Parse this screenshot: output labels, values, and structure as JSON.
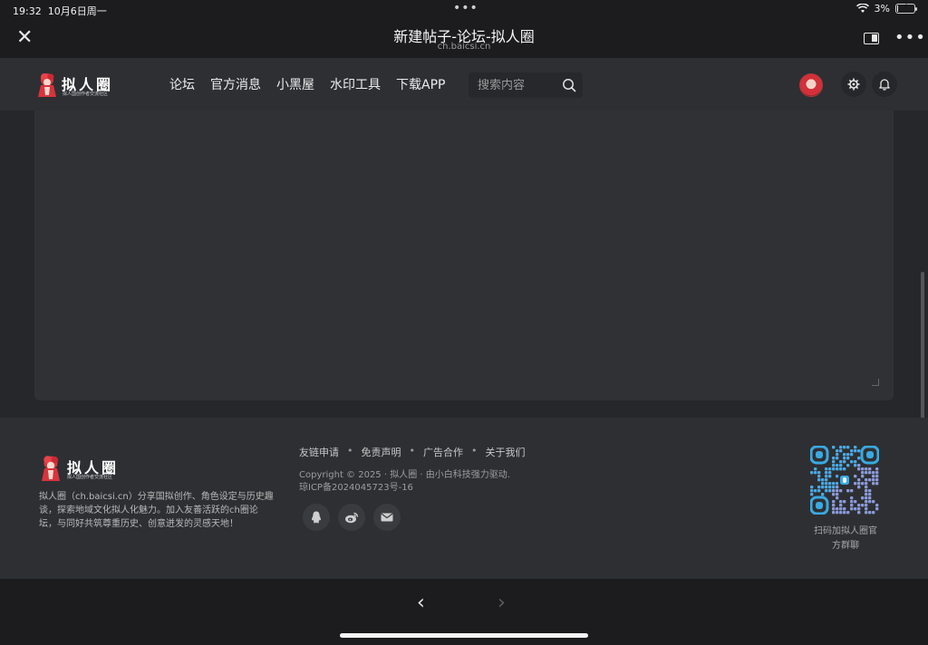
{
  "status": {
    "time": "19:32",
    "date": "10月6日周一",
    "battery": "3%",
    "battery_level": 0.03
  },
  "browser": {
    "title": "新建帖子-论坛-拟人圈",
    "url": "ch.baicsi.cn",
    "close_icon": "close-icon",
    "more_icon": "more-icon"
  },
  "site": {
    "logo_name": "拟人圈",
    "logo_tagline": "拟人国创作者交流社区",
    "nav": [
      "论坛",
      "官方消息",
      "小黑屋",
      "水印工具",
      "下载APP"
    ],
    "search_placeholder": "搜索内容"
  },
  "footer": {
    "logo_name": "拟人圈",
    "logo_tagline": "拟人国创作者交流社区",
    "description": "拟人圈（ch.baicsi.cn）分享国拟创作、角色设定与历史趣谈，探索地域文化拟人化魅力。加入友善活跃的ch圈论坛，与同好共筑尊重历史、创意迸发的灵感天地！",
    "links": [
      "友链申请",
      "免责声明",
      "广告合作",
      "关于我们"
    ],
    "link_separator": "•",
    "copyright": "Copyright © 2025 · 拟人圈 · 由小白科技强力驱动.",
    "icp": "琼ICP备2024045723号-16",
    "social_icons": [
      "qq-icon",
      "weibo-icon",
      "mail-icon"
    ],
    "qr_caption_line1": "扫码加拟人圈官",
    "qr_caption_line2": "方群聊"
  },
  "colors": {
    "accent": "#3aa9e0",
    "page_bg": "#26272a",
    "nav_bg": "#2e2f33"
  }
}
